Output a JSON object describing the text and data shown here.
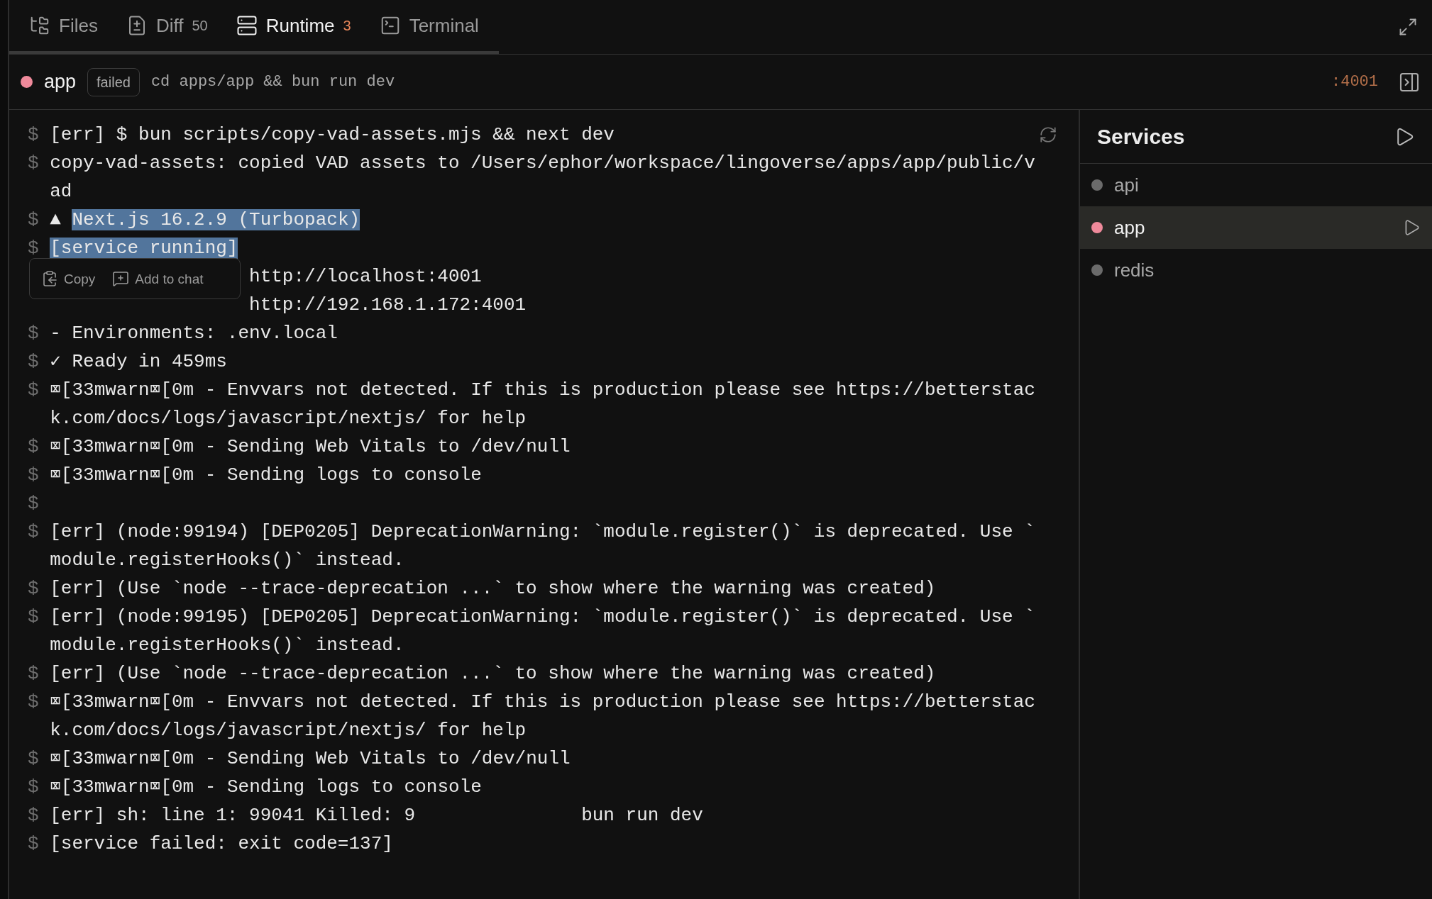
{
  "tabs": [
    {
      "kind": "files",
      "label": "Files",
      "selected": false
    },
    {
      "kind": "diff",
      "label": "Diff",
      "badge": "50",
      "selected": false
    },
    {
      "kind": "runtime",
      "label": "Runtime",
      "badge": "3",
      "selected": true
    },
    {
      "kind": "terminal",
      "label": "Terminal",
      "selected": false
    }
  ],
  "header": {
    "service": "app",
    "color": "#ef8a9b",
    "status": "failed",
    "command": "cd apps/app && bun run dev",
    "port": ":4001"
  },
  "log": {
    "lines": [
      {
        "prompt": "$",
        "text": "[err] $ bun scripts/copy-vad-assets.mjs && next dev",
        "selected": false
      },
      {
        "prompt": "$",
        "text": "copy-vad-assets: copied VAD assets to /Users/ephor/workspace/lingoverse/apps/app/public/vad",
        "selected": false
      },
      {
        "prompt": "$",
        "marker": "▲",
        "text": "Next.js 16.2.9 (Turbopack)",
        "selected": true
      },
      {
        "prompt": "$",
        "text": "[service running]",
        "selected": true
      },
      {
        "text": "http://localhost:4001",
        "selected": false
      },
      {
        "text": "http://192.168.1.172:4001",
        "selected": false
      },
      {
        "prompt": "$",
        "text": "- Environments: .env.local",
        "selected": false
      },
      {
        "prompt": "$",
        "marker": "✓",
        "text": "Ready in 459ms",
        "selected": false
      },
      {
        "prompt": "$",
        "text": "⌧[33mwarn⌧[0m - Envvars not detected. If this is production please see https://betterstack.com/docs/logs/javascript/nextjs/ for help",
        "selected": false
      },
      {
        "prompt": "$",
        "text": "⌧[33mwarn⌧[0m - Sending Web Vitals to /dev/null",
        "selected": false
      },
      {
        "prompt": "$",
        "text": "⌧[33mwarn⌧[0m - Sending logs to console",
        "selected": false
      },
      {
        "prompt": "$"
      },
      {
        "prompt": "$",
        "text": "[err] (node:99194) [DEP0205] DeprecationWarning: `module.register()` is deprecated. Use `module.registerHooks()` instead.",
        "selected": false
      },
      {
        "prompt": "$",
        "text": "[err] (Use `node --trace-deprecation ...` to show where the warning was created)",
        "selected": false
      },
      {
        "prompt": "$",
        "text": "[err] (node:99195) [DEP0205] DeprecationWarning: `module.register()` is deprecated. Use `module.registerHooks()` instead.",
        "selected": false
      },
      {
        "prompt": "$",
        "text": "[err] (Use `node --trace-deprecation ...` to show where the warning was created)",
        "selected": false
      },
      {
        "prompt": "$",
        "text": "⌧[33mwarn⌧[0m - Envvars not detected. If this is production please see https://betterstack.com/docs/logs/javascript/nextjs/ for help",
        "selected": false
      },
      {
        "prompt": "$",
        "text": "⌧[33mwarn⌧[0m - Sending Web Vitals to /dev/null",
        "selected": false
      },
      {
        "prompt": "$",
        "text": "⌧[33mwarn⌧[0m - Sending logs to console",
        "selected": false
      },
      {
        "prompt": "$",
        "text": "[err] sh: line 1: 99041 Killed: 9               bun run dev",
        "selected": false
      },
      {
        "prompt": "$",
        "text": "[service failed: exit code=137]",
        "selected": false
      }
    ]
  },
  "selection_menu": [
    {
      "kind": "copy",
      "label": "Copy"
    },
    {
      "kind": "chat",
      "label": "Add to chat"
    }
  ],
  "services": {
    "title": "Services",
    "items": [
      {
        "name": "api",
        "color": "#6b6b6b",
        "selected": false
      },
      {
        "name": "app",
        "color": "#ef8a9b",
        "selected": true
      },
      {
        "name": "redis",
        "color": "#6b6b6b",
        "selected": false
      }
    ]
  }
}
